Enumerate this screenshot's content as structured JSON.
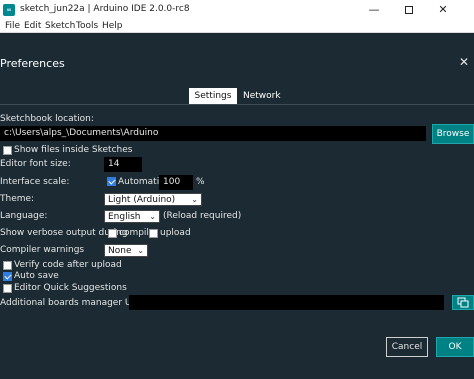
{
  "window": {
    "title": "sketch_jun22a | Arduino IDE 2.0.0-rc8",
    "app_icon": "∞",
    "min_glyph": "—",
    "close_glyph": "✕"
  },
  "menu": [
    "File",
    "Edit",
    "Sketch",
    "Tools",
    "Help"
  ],
  "dialog": {
    "title": "Preferences",
    "close_glyph": "✕",
    "tabs": {
      "settings": "Settings",
      "network": "Network"
    }
  },
  "settings": {
    "sketchbook_label": "Sketchbook location:",
    "sketchbook_value": "c:\\Users\\alps_\\Documents\\Arduino",
    "browse_label": "Browse",
    "show_files_label": "Show files inside Sketches",
    "font_size_label": "Editor font size:",
    "font_size_value": "14",
    "interface_scale_label": "Interface scale:",
    "automatic_label": "Automatic",
    "scale_value": "100",
    "percent": "%",
    "theme_label": "Theme:",
    "theme_value": "Light (Arduino)",
    "language_label": "Language:",
    "language_value": "English",
    "language_note": "(Reload required)",
    "verbose_label": "Show verbose output during",
    "compile_label": "compile",
    "upload_label": "upload",
    "compiler_warnings_label": "Compiler warnings",
    "compiler_warnings_value": "None",
    "verify_label": "Verify code after upload",
    "auto_save_label": "Auto save",
    "quick_suggestions_label": "Editor Quick Suggestions",
    "boards_urls_label": "Additional boards manager URLs:",
    "boards_urls_value": ""
  },
  "states": {
    "show_files": false,
    "automatic": true,
    "verbose_compile": false,
    "verbose_upload": false,
    "verify": false,
    "auto_save": true,
    "quick_suggestions": false
  },
  "footer": {
    "cancel_label": "Cancel",
    "ok_label": "OK"
  },
  "colors": {
    "background": "#1b2a33",
    "accent": "#008184",
    "field": "#000000",
    "checkbox_checked": "#2f7de1"
  },
  "icons": {
    "app": "arduino-icon",
    "boards_edit": "edit-window-icon"
  }
}
